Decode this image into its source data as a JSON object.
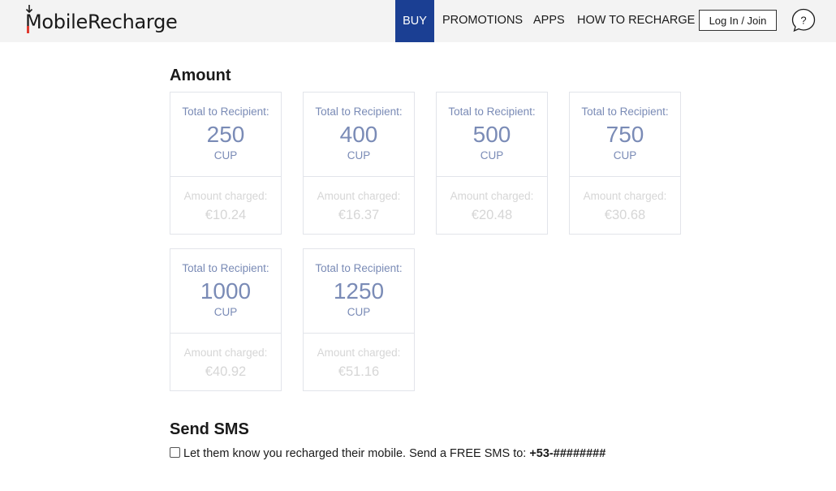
{
  "header": {
    "logo_text": "obileRecharge",
    "logo_initial": "M",
    "nav": {
      "buy": "BUY",
      "promotions": "PROMOTIONS",
      "apps": "APPS",
      "how_to_recharge": "HOW TO RECHARGE"
    },
    "login_label": "Log In / Join",
    "help_label": "?"
  },
  "amount_section": {
    "title": "Amount",
    "cards": [
      {
        "recipient_label": "Total to Recipient:",
        "amount": "250",
        "currency": "CUP",
        "charged_label": "Amount charged:",
        "charged": "€10.24"
      },
      {
        "recipient_label": "Total to Recipient:",
        "amount": "400",
        "currency": "CUP",
        "charged_label": "Amount charged:",
        "charged": "€16.37"
      },
      {
        "recipient_label": "Total to Recipient:",
        "amount": "500",
        "currency": "CUP",
        "charged_label": "Amount charged:",
        "charged": "€20.48"
      },
      {
        "recipient_label": "Total to Recipient:",
        "amount": "750",
        "currency": "CUP",
        "charged_label": "Amount charged:",
        "charged": "€30.68"
      },
      {
        "recipient_label": "Total to Recipient:",
        "amount": "1000",
        "currency": "CUP",
        "charged_label": "Amount charged:",
        "charged": "€40.92"
      },
      {
        "recipient_label": "Total to Recipient:",
        "amount": "1250",
        "currency": "CUP",
        "charged_label": "Amount charged:",
        "charged": "€51.16"
      }
    ]
  },
  "sms_section": {
    "title": "Send SMS",
    "checkbox_label": "Let them know you recharged their mobile. Send a FREE SMS to:",
    "phone_number": "+53-########",
    "checked": false
  },
  "colors": {
    "nav_active_bg": "#1b3f93",
    "card_text": "#7a8bb6",
    "card_muted": "#d6d6d6",
    "logo_accent": "#e03a2f"
  }
}
